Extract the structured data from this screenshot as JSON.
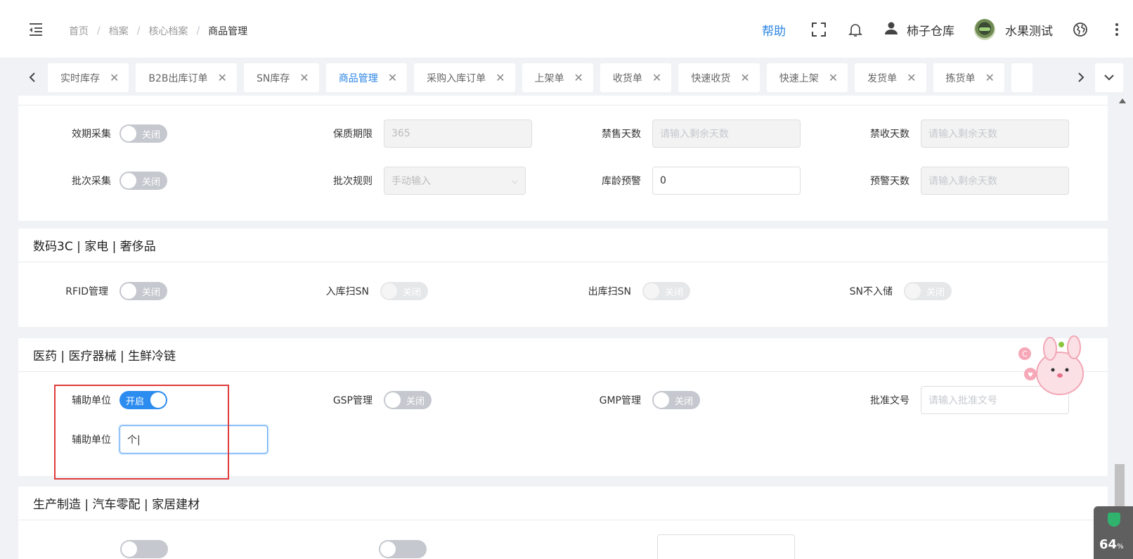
{
  "header": {
    "breadcrumb": [
      "首页",
      "档案",
      "核心档案",
      "商品管理"
    ],
    "help": "帮助",
    "warehouse": "柿子仓库",
    "user_name": "水果测试"
  },
  "tags": [
    {
      "label": "实时库存",
      "active": false
    },
    {
      "label": "B2B出库订单",
      "active": false
    },
    {
      "label": "SN库存",
      "active": false
    },
    {
      "label": "商品管理",
      "active": true
    },
    {
      "label": "采购入库订单",
      "active": false
    },
    {
      "label": "上架单",
      "active": false
    },
    {
      "label": "收货单",
      "active": false
    },
    {
      "label": "快速收货",
      "active": false
    },
    {
      "label": "快速上架",
      "active": false
    },
    {
      "label": "发货单",
      "active": false
    },
    {
      "label": "拣货单",
      "active": false
    }
  ],
  "section_validity": {
    "expiry_collect": {
      "label": "效期采集",
      "switch": "关闭"
    },
    "shelf_life": {
      "label": "保质期限",
      "value": "365"
    },
    "no_sale_days": {
      "label": "禁售天数",
      "placeholder": "请输入剩余天数"
    },
    "no_receive_days": {
      "label": "禁收天数",
      "placeholder": "请输入剩余天数"
    },
    "batch_collect": {
      "label": "批次采集",
      "switch": "关闭"
    },
    "batch_rule": {
      "label": "批次规则",
      "value": "手动输入"
    },
    "age_warning": {
      "label": "库龄预警",
      "value": "0"
    },
    "warning_days": {
      "label": "预警天数",
      "placeholder": "请输入剩余天数"
    }
  },
  "section_digital": {
    "title": "数码3C | 家电 | 奢侈品",
    "rfid": {
      "label": "RFID管理",
      "switch": "关闭"
    },
    "in_scan_sn": {
      "label": "入库扫SN",
      "switch": "关闭"
    },
    "out_scan_sn": {
      "label": "出库扫SN",
      "switch": "关闭"
    },
    "sn_no_store": {
      "label": "SN不入储",
      "switch": "关闭"
    }
  },
  "section_medical": {
    "title": "医药 | 医疗器械 | 生鲜冷链",
    "aux_unit_switch": {
      "label": "辅助单位",
      "switch": "开启"
    },
    "gsp": {
      "label": "GSP管理",
      "switch": "关闭"
    },
    "gmp": {
      "label": "GMP管理",
      "switch": "关闭"
    },
    "approval_no": {
      "label": "批准文号",
      "placeholder": "请输入批准文号"
    },
    "aux_unit_input": {
      "label": "辅助单位",
      "value": "个|"
    }
  },
  "section_manufacture": {
    "title": "生产制造 | 汽车零配 | 家居建材"
  },
  "widget": {
    "percent": "64",
    "unit": "%"
  }
}
